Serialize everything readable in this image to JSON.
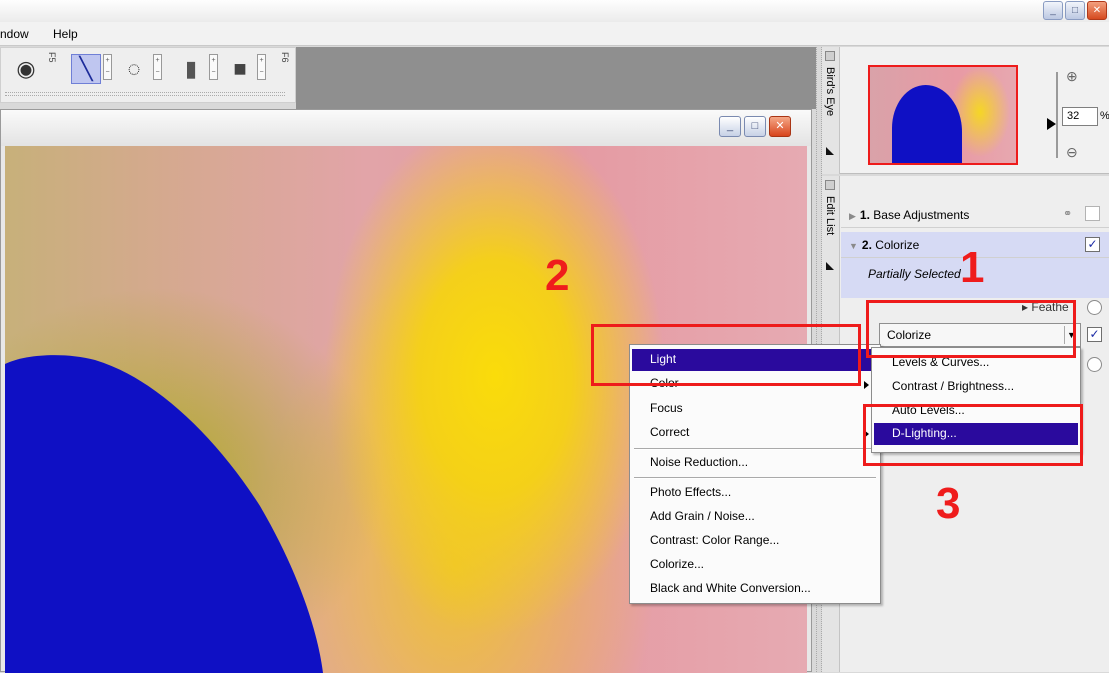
{
  "menubar": {
    "items": [
      "ndow",
      "Help"
    ]
  },
  "toolbar": {
    "hotkeys": [
      "F5",
      "F6"
    ]
  },
  "zoom": {
    "value": "32",
    "unit": "%"
  },
  "panels": {
    "birdseye_label": "Bird's Eye",
    "editlist_label": "Edit List"
  },
  "steps": [
    {
      "num": "1.",
      "label": "Base Adjustments"
    },
    {
      "num": "2.",
      "label": "Colorize",
      "checked": "✓"
    }
  ],
  "selection_text": "Partially Selected",
  "feather_label": "Feathe",
  "select": {
    "value": "Colorize",
    "checked": "✓"
  },
  "menu_main": {
    "items": [
      "Light",
      "Color",
      "Focus",
      "Correct",
      "Noise Reduction...",
      "Photo Effects...",
      "Add Grain / Noise...",
      "Contrast: Color Range...",
      "Colorize...",
      "Black and White Conversion..."
    ]
  },
  "menu_sub": {
    "items": [
      "Levels & Curves...",
      "Contrast / Brightness...",
      "Auto Levels...",
      "D-Lighting..."
    ]
  },
  "annotations": [
    "1",
    "2",
    "3"
  ],
  "colors": {
    "highlight": "#2a0a9d",
    "annotation": "#ee1b1b",
    "paint": "#0f10c4"
  }
}
